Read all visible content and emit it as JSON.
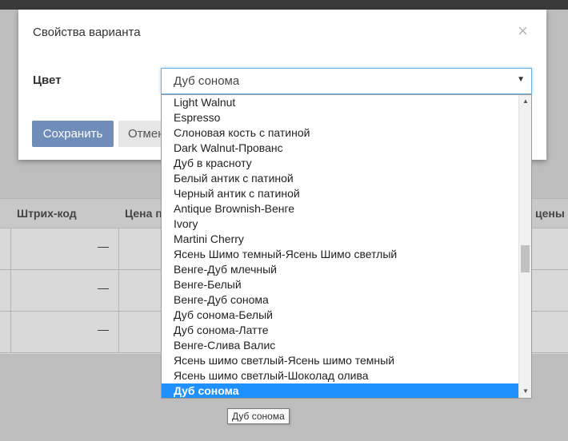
{
  "background_table": {
    "headers": {
      "barcode": "Штрих-код",
      "price": "Цена п",
      "prices": "цены"
    },
    "dash": "—"
  },
  "modal": {
    "title": "Свойства варианта",
    "close_glyph": "×",
    "field_label": "Цвет",
    "select_value": "Дуб сонома",
    "select_arrow": "▼",
    "save_label": "Сохранить",
    "cancel_label": "Отмена"
  },
  "dropdown": {
    "options": [
      "Light Walnut",
      "Espresso",
      "Слоновая кость с патиной",
      "Dark Walnut-Прованс",
      "Дуб в красноту",
      "Белый антик с патиной",
      "Черный антик с патиной",
      "Antique Brownish-Венге",
      "Ivory",
      "Martini Cherry",
      "Ясень Шимо темный-Ясень Шимо светлый",
      "Венге-Дуб млечный",
      "Венге-Белый",
      "Венге-Дуб сонома",
      "Дуб сонома-Белый",
      "Дуб сонома-Латте",
      "Венге-Слива Валис",
      "Ясень шимо светлый-Ясень шимо темный",
      "Ясень шимо светлый-Шоколад олива",
      "Дуб сонома"
    ],
    "selected_index": 19,
    "scroll_position": 0.55,
    "scroll_up_glyph": "▲",
    "scroll_down_glyph": "▼"
  },
  "tooltip": "Дуб сонома",
  "colors": {
    "accent": "#66afe9",
    "selected": "#1e90ff",
    "save_button": "#6f8db8"
  }
}
